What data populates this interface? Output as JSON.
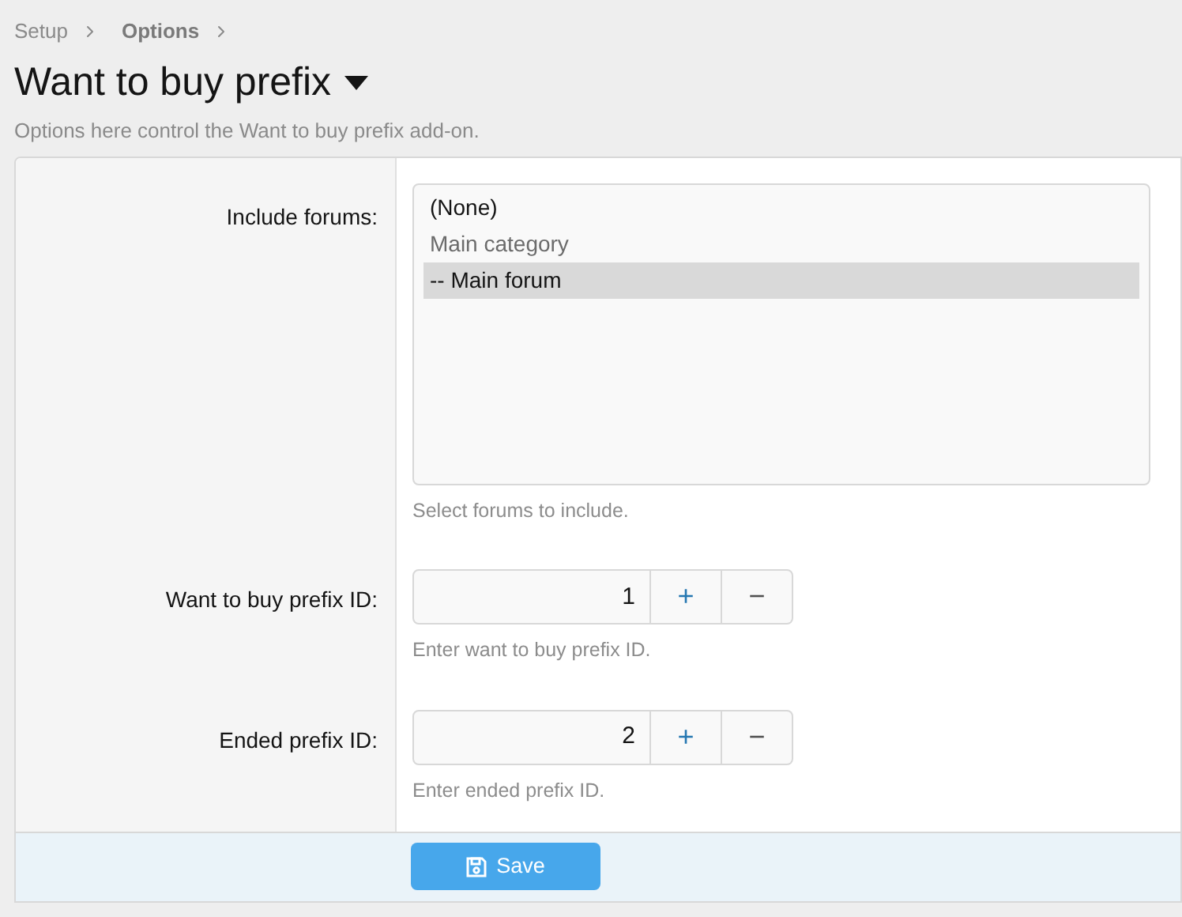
{
  "breadcrumbs": [
    {
      "label": "Setup",
      "current": false
    },
    {
      "label": "Options",
      "current": true
    }
  ],
  "title": "Want to buy prefix",
  "description": "Options here control the Want to buy prefix add-on.",
  "fields": [
    {
      "kind": "multiselect",
      "label": "Include forums:",
      "options": [
        {
          "label": "(None)",
          "selected": false,
          "disabled": false
        },
        {
          "label": "Main category",
          "selected": false,
          "disabled": true
        },
        {
          "label": "-- Main forum",
          "selected": true,
          "disabled": false
        }
      ],
      "hint": "Select forums to include."
    },
    {
      "kind": "number",
      "label": "Want to buy prefix ID:",
      "value": "1",
      "increment": "+",
      "decrement": "−",
      "hint": "Enter want to buy prefix ID."
    },
    {
      "kind": "number",
      "label": "Ended prefix ID:",
      "value": "2",
      "increment": "+",
      "decrement": "−",
      "hint": "Enter ended prefix ID."
    }
  ],
  "save_button": "Save"
}
